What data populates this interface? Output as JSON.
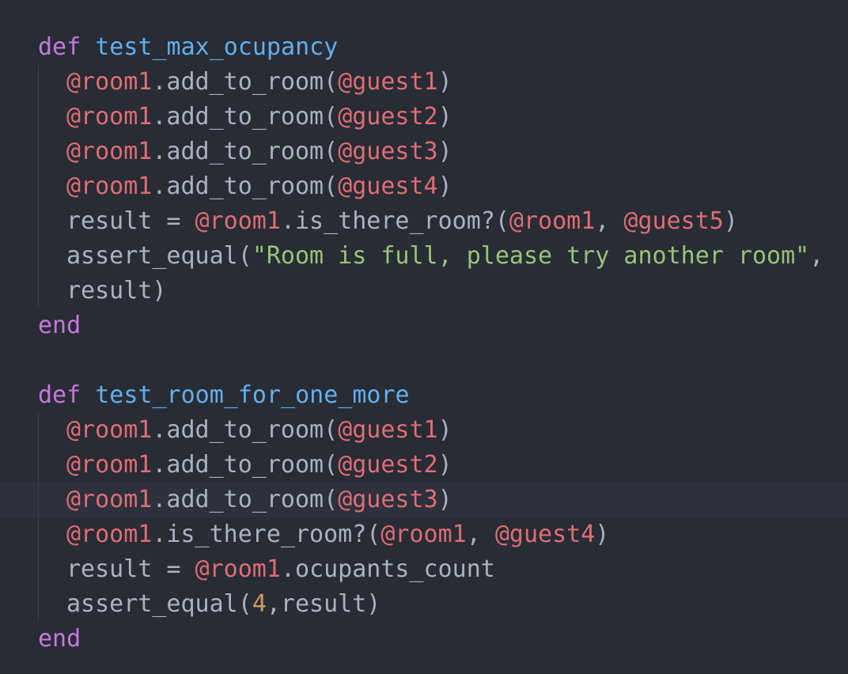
{
  "theme": {
    "background": "#282c34",
    "current_line": "#2c313c",
    "indent_guide": "#3b4048",
    "keyword": "#c678dd",
    "function_name": "#61afef",
    "instance_variable": "#e06c75",
    "string": "#98c379",
    "number": "#d19a66",
    "default_text": "#abb2bf"
  },
  "editor": {
    "lines": [
      {
        "indent": 0,
        "tokens": [
          {
            "t": "def",
            "c": "kw"
          },
          {
            "t": " ",
            "c": "plain"
          },
          {
            "t": "test_max_ocupancy",
            "c": "fn"
          }
        ]
      },
      {
        "indent": 1,
        "tokens": [
          {
            "t": "@room1",
            "c": "ivar"
          },
          {
            "t": ".add_to_room(",
            "c": "plain"
          },
          {
            "t": "@guest1",
            "c": "ivar"
          },
          {
            "t": ")",
            "c": "plain"
          }
        ]
      },
      {
        "indent": 1,
        "tokens": [
          {
            "t": "@room1",
            "c": "ivar"
          },
          {
            "t": ".add_to_room(",
            "c": "plain"
          },
          {
            "t": "@guest2",
            "c": "ivar"
          },
          {
            "t": ")",
            "c": "plain"
          }
        ]
      },
      {
        "indent": 1,
        "tokens": [
          {
            "t": "@room1",
            "c": "ivar"
          },
          {
            "t": ".add_to_room(",
            "c": "plain"
          },
          {
            "t": "@guest3",
            "c": "ivar"
          },
          {
            "t": ")",
            "c": "plain"
          }
        ]
      },
      {
        "indent": 1,
        "tokens": [
          {
            "t": "@room1",
            "c": "ivar"
          },
          {
            "t": ".add_to_room(",
            "c": "plain"
          },
          {
            "t": "@guest4",
            "c": "ivar"
          },
          {
            "t": ")",
            "c": "plain"
          }
        ]
      },
      {
        "indent": 1,
        "tokens": [
          {
            "t": "result = ",
            "c": "plain"
          },
          {
            "t": "@room1",
            "c": "ivar"
          },
          {
            "t": ".is_there_room?(",
            "c": "plain"
          },
          {
            "t": "@room1",
            "c": "ivar"
          },
          {
            "t": ", ",
            "c": "plain"
          },
          {
            "t": "@guest5",
            "c": "ivar"
          },
          {
            "t": ")",
            "c": "plain"
          }
        ]
      },
      {
        "indent": 1,
        "tokens": [
          {
            "t": "assert_equal(",
            "c": "plain"
          },
          {
            "t": "\"Room is full, please try another room\"",
            "c": "str"
          },
          {
            "t": ",",
            "c": "plain"
          }
        ]
      },
      {
        "indent": 1,
        "tokens": [
          {
            "t": "result)",
            "c": "plain"
          }
        ]
      },
      {
        "indent": 0,
        "tokens": [
          {
            "t": "end",
            "c": "kw"
          }
        ]
      },
      {
        "indent": 0,
        "tokens": []
      },
      {
        "indent": 0,
        "tokens": [
          {
            "t": "def",
            "c": "kw"
          },
          {
            "t": " ",
            "c": "plain"
          },
          {
            "t": "test_room_for_one_more",
            "c": "fn"
          }
        ]
      },
      {
        "indent": 1,
        "tokens": [
          {
            "t": "@room1",
            "c": "ivar"
          },
          {
            "t": ".add_to_room(",
            "c": "plain"
          },
          {
            "t": "@guest1",
            "c": "ivar"
          },
          {
            "t": ")",
            "c": "plain"
          }
        ]
      },
      {
        "indent": 1,
        "tokens": [
          {
            "t": "@room1",
            "c": "ivar"
          },
          {
            "t": ".add_to_room(",
            "c": "plain"
          },
          {
            "t": "@guest2",
            "c": "ivar"
          },
          {
            "t": ")",
            "c": "plain"
          }
        ]
      },
      {
        "indent": 1,
        "highlight": true,
        "tokens": [
          {
            "t": "@room1",
            "c": "ivar"
          },
          {
            "t": ".add_to_room(",
            "c": "plain"
          },
          {
            "t": "@guest3",
            "c": "ivar"
          },
          {
            "t": ")",
            "c": "plain"
          }
        ]
      },
      {
        "indent": 1,
        "tokens": [
          {
            "t": "@room1",
            "c": "ivar"
          },
          {
            "t": ".is_there_room?(",
            "c": "plain"
          },
          {
            "t": "@room1",
            "c": "ivar"
          },
          {
            "t": ", ",
            "c": "plain"
          },
          {
            "t": "@guest4",
            "c": "ivar"
          },
          {
            "t": ")",
            "c": "plain"
          }
        ]
      },
      {
        "indent": 1,
        "tokens": [
          {
            "t": "result = ",
            "c": "plain"
          },
          {
            "t": "@room1",
            "c": "ivar"
          },
          {
            "t": ".ocupants_count",
            "c": "plain"
          }
        ]
      },
      {
        "indent": 1,
        "tokens": [
          {
            "t": "assert_equal(",
            "c": "plain"
          },
          {
            "t": "4",
            "c": "num"
          },
          {
            "t": ",result)",
            "c": "plain"
          }
        ]
      },
      {
        "indent": 0,
        "tokens": [
          {
            "t": "end",
            "c": "kw"
          }
        ]
      }
    ]
  }
}
